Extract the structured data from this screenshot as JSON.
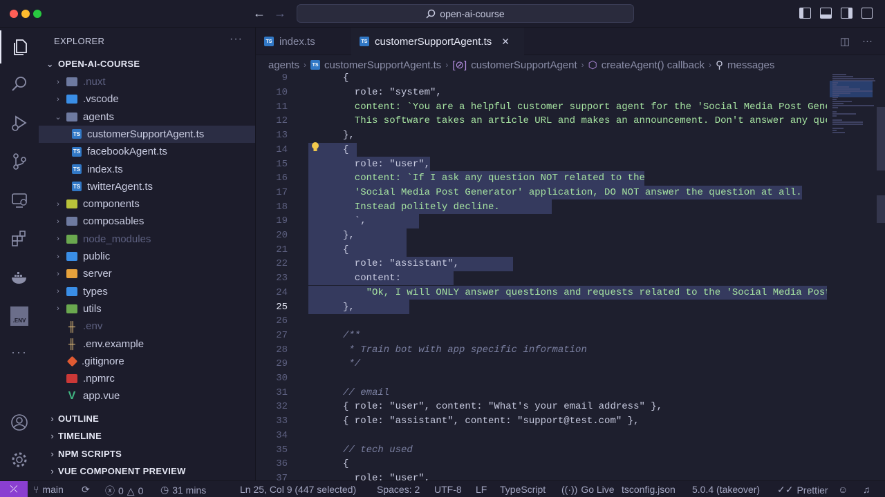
{
  "window": {
    "search_text": "open-ai-course"
  },
  "sidebar": {
    "title": "EXPLORER",
    "more": "···",
    "root": "OPEN-AI-COURSE",
    "items": [
      {
        "label": ".nuxt",
        "kind": "folder",
        "icon": "folder-icon",
        "dim": true
      },
      {
        "label": ".vscode",
        "kind": "folder",
        "icon": "vscode-folder-icon"
      },
      {
        "label": "agents",
        "kind": "folder-open",
        "icon": "folder-open-icon"
      },
      {
        "label": "customerSupportAgent.ts",
        "kind": "file",
        "icon": "typescript-file-icon",
        "selected": true
      },
      {
        "label": "facebookAgent.ts",
        "kind": "file",
        "icon": "typescript-file-icon"
      },
      {
        "label": "index.ts",
        "kind": "file",
        "icon": "typescript-file-icon"
      },
      {
        "label": "twitterAgent.ts",
        "kind": "file",
        "icon": "typescript-file-icon"
      },
      {
        "label": "components",
        "kind": "folder",
        "icon": "components-folder-icon"
      },
      {
        "label": "composables",
        "kind": "folder",
        "icon": "folder-icon"
      },
      {
        "label": "node_modules",
        "kind": "folder",
        "icon": "node-folder-icon",
        "dim": true
      },
      {
        "label": "public",
        "kind": "folder",
        "icon": "public-folder-icon"
      },
      {
        "label": "server",
        "kind": "folder",
        "icon": "server-folder-icon"
      },
      {
        "label": "types",
        "kind": "folder",
        "icon": "types-folder-icon"
      },
      {
        "label": "utils",
        "kind": "folder",
        "icon": "utils-folder-icon"
      },
      {
        "label": ".env",
        "kind": "file",
        "icon": "env-file-icon",
        "dim": true
      },
      {
        "label": ".env.example",
        "kind": "file",
        "icon": "env-file-icon"
      },
      {
        "label": ".gitignore",
        "kind": "file",
        "icon": "git-file-icon"
      },
      {
        "label": ".npmrc",
        "kind": "file",
        "icon": "npm-file-icon"
      },
      {
        "label": "app.vue",
        "kind": "file",
        "icon": "vue-file-icon"
      }
    ],
    "sections": [
      "OUTLINE",
      "TIMELINE",
      "NPM SCRIPTS",
      "VUE COMPONENT PREVIEW"
    ]
  },
  "tabs": [
    {
      "label": "index.ts",
      "active": false
    },
    {
      "label": "customerSupportAgent.ts",
      "active": true
    }
  ],
  "breadcrumbs": [
    "agents",
    "customerSupportAgent.ts",
    "customerSupportAgent",
    "createAgent() callback",
    "messages"
  ],
  "editor": {
    "lines": [
      {
        "n": "9",
        "t": "{"
      },
      {
        "n": "10",
        "t": "  role: \"system\","
      },
      {
        "n": "11",
        "t": "  content: `You are a helpful customer support agent for the 'Social Media Post Gene"
      },
      {
        "n": "12",
        "t": "  This software takes an article URL and makes an announcement. Don't answer any que"
      },
      {
        "n": "13",
        "t": "},"
      },
      {
        "n": "14",
        "t": "{"
      },
      {
        "n": "15",
        "t": "  role: \"user\","
      },
      {
        "n": "16",
        "t": "  content: `If I ask any question NOT related to the"
      },
      {
        "n": "17",
        "t": "  'Social Media Post Generator' application, DO NOT answer the question at all."
      },
      {
        "n": "18",
        "t": "  Instead politely decline."
      },
      {
        "n": "19",
        "t": "  `,"
      },
      {
        "n": "20",
        "t": "},"
      },
      {
        "n": "21",
        "t": "{"
      },
      {
        "n": "22",
        "t": "  role: \"assistant\","
      },
      {
        "n": "23",
        "t": "  content:"
      },
      {
        "n": "24",
        "t": "    \"Ok, I will ONLY answer questions and requests related to the 'Social Media Post"
      },
      {
        "n": "25",
        "t": "},"
      },
      {
        "n": "26",
        "t": ""
      },
      {
        "n": "27",
        "t": "/**"
      },
      {
        "n": "28",
        "t": " * Train bot with app specific information"
      },
      {
        "n": "29",
        "t": " */"
      },
      {
        "n": "30",
        "t": ""
      },
      {
        "n": "31",
        "t": "// email"
      },
      {
        "n": "32",
        "t": "{ role: \"user\", content: \"What's your email address\" },"
      },
      {
        "n": "33",
        "t": "{ role: \"assistant\", content: \"support@test.com\" },"
      },
      {
        "n": "34",
        "t": ""
      },
      {
        "n": "35",
        "t": "// tech used"
      },
      {
        "n": "36",
        "t": "{"
      },
      {
        "n": "37",
        "t": "  role: \"user\","
      }
    ]
  },
  "status": {
    "branch": "main",
    "errors": "0",
    "warnings": "0",
    "time": "31 mins",
    "position": "Ln 25, Col 9 (447 selected)",
    "spaces": "Spaces: 2",
    "encoding": "UTF-8",
    "eol": "LF",
    "language": "TypeScript",
    "golive": "Go Live",
    "tsconfig": "tsconfig.json",
    "tsversion": "5.0.4 (takeover)",
    "prettier": "Prettier"
  },
  "colors": {
    "accent": "#8a3fd1",
    "string": "#a6e3a1",
    "selection": "#3a3f66"
  }
}
